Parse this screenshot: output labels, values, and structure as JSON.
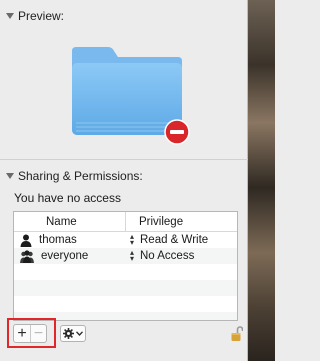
{
  "sections": {
    "preview_label": "Preview:",
    "sharing_label": "Sharing & Permissions:"
  },
  "access_status": "You have no access",
  "table": {
    "columns": [
      "Name",
      "Privilege"
    ],
    "rows": [
      {
        "name": "thomas",
        "privilege": "Read & Write",
        "icon": "single-user-icon"
      },
      {
        "name": "everyone",
        "privilege": "No Access",
        "icon": "group-users-icon"
      }
    ]
  },
  "toolbar": {
    "add_label": "+",
    "remove_label": "−",
    "action_icon": "gear-icon",
    "lock_icon": "unlocked-padlock-icon"
  },
  "colors": {
    "folder_blue": "#6db8f0",
    "no_access_badge": "#d8262a",
    "highlight_box": "#e0282a",
    "lock_gold": "#d7a23a"
  }
}
